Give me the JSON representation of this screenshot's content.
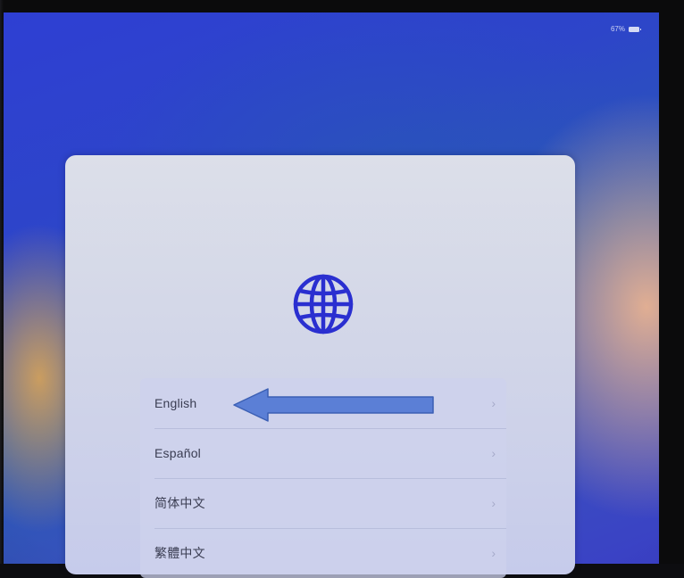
{
  "status_bar": {
    "battery_text": "67%",
    "battery_icon": "battery-icon"
  },
  "setup": {
    "hero_icon": "globe-icon",
    "hero_color": "#2a2fd0",
    "languages": [
      {
        "label": "English"
      },
      {
        "label": "Español"
      },
      {
        "label": "简体中文"
      },
      {
        "label": "繁體中文"
      }
    ]
  },
  "annotation": {
    "arrow_icon": "left-arrow-annotation",
    "arrow_color": "#5b7fd6",
    "points_to": "English"
  }
}
